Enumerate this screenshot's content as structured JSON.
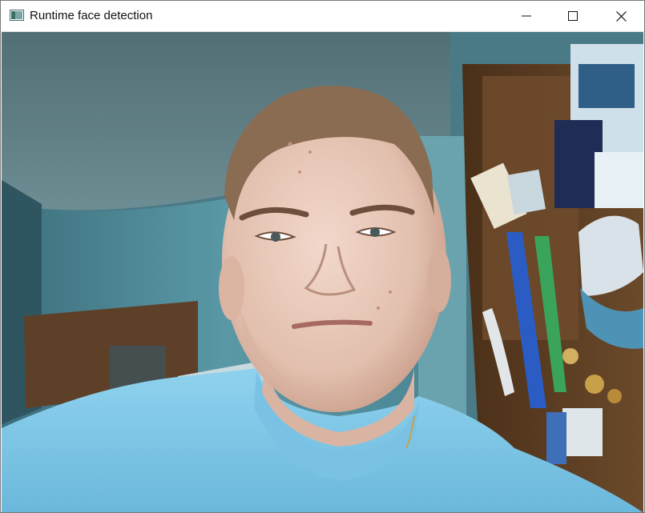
{
  "window": {
    "title": "Runtime face detection",
    "icon": "app-window-icon",
    "controls": {
      "minimize": "minimize-icon",
      "maximize": "maximize-icon",
      "close": "close-icon"
    }
  },
  "camera_feed": {
    "description_icon": "webcam-frame",
    "colors": {
      "ceiling": "#5e7d83",
      "wall": "#4f8a98",
      "door": "#6a4a2e",
      "shirt": "#7cc5e6",
      "skin": "#e7c6b6",
      "hair": "#8c6e52",
      "cabinet": "#5a3c22"
    }
  }
}
